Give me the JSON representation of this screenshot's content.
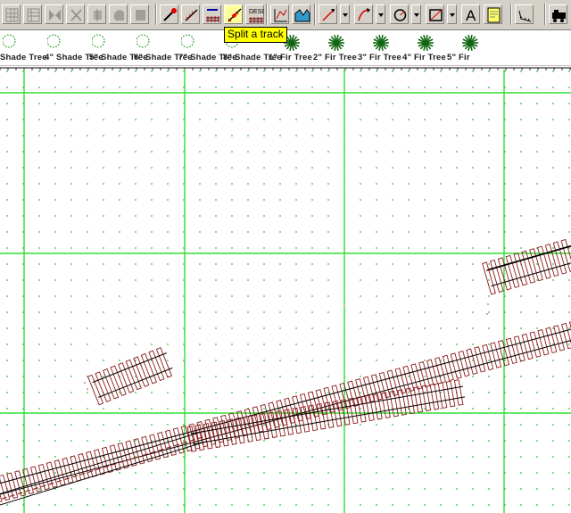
{
  "toolbar": {
    "tooltip": "Split a track",
    "buttons": [
      {
        "name": "layer-grid-icon",
        "state": "disabled"
      },
      {
        "name": "layer-grid-alt-icon",
        "state": "disabled"
      },
      {
        "name": "mirror-icon",
        "state": "disabled"
      },
      {
        "name": "rotate-icon",
        "state": "disabled"
      },
      {
        "name": "align-icon",
        "state": "disabled"
      },
      {
        "name": "shape-icon",
        "state": "disabled"
      },
      {
        "name": "solid-icon",
        "state": "disabled"
      },
      {
        "name": "modify-track-icon",
        "state": "enabled"
      },
      {
        "name": "extend-track-icon",
        "state": "enabled"
      },
      {
        "name": "connect-track-icon",
        "state": "enabled"
      },
      {
        "name": "split-track-icon",
        "state": "selected"
      },
      {
        "name": "elevation-track-icon",
        "state": "enabled"
      },
      {
        "name": "profile-track-icon",
        "state": "enabled"
      },
      {
        "name": "tunnel-icon",
        "state": "enabled"
      },
      {
        "name": "straight-line-icon",
        "state": "enabled"
      },
      {
        "name": "curve-line-icon",
        "state": "enabled"
      },
      {
        "name": "circle-icon",
        "state": "enabled"
      },
      {
        "name": "box-icon",
        "state": "enabled"
      },
      {
        "name": "text-icon",
        "state": "enabled",
        "glyph": "A"
      },
      {
        "name": "note-icon",
        "state": "enabled"
      },
      {
        "name": "ruler-icon",
        "state": "enabled"
      },
      {
        "name": "train-icon",
        "state": "enabled"
      }
    ],
    "colors": {
      "face": "#d4d0c8",
      "tooltip_bg": "#ffff00"
    }
  },
  "palette": {
    "items": [
      {
        "label": "Shade Tree",
        "icon": "shade-tree-icon"
      },
      {
        "label": "4\" Shade Tree",
        "icon": "shade-tree-icon"
      },
      {
        "label": "5\" Shade Tree",
        "icon": "shade-tree-icon"
      },
      {
        "label": "6\" Shade Tree",
        "icon": "shade-tree-icon"
      },
      {
        "label": "7\" Shade Tree",
        "icon": "shade-tree-icon"
      },
      {
        "label": "8\" Shade Tree",
        "icon": "shade-tree-icon"
      },
      {
        "label": "1\" Fir Tree",
        "icon": "fir-tree-icon"
      },
      {
        "label": "2\" Fir Tree",
        "icon": "fir-tree-icon"
      },
      {
        "label": "3\" Fir Tree",
        "icon": "fir-tree-icon"
      },
      {
        "label": "4\" Fir Tree",
        "icon": "fir-tree-icon"
      },
      {
        "label": "5\" Fir",
        "icon": "fir-tree-icon"
      }
    ]
  },
  "canvas": {
    "colors": {
      "background": "#ffffff",
      "major_grid": "#33dd33",
      "minor_dots": "#33cc33",
      "rail": "#000000",
      "tie": "#8b1a1a",
      "ruler": "#000000"
    }
  }
}
